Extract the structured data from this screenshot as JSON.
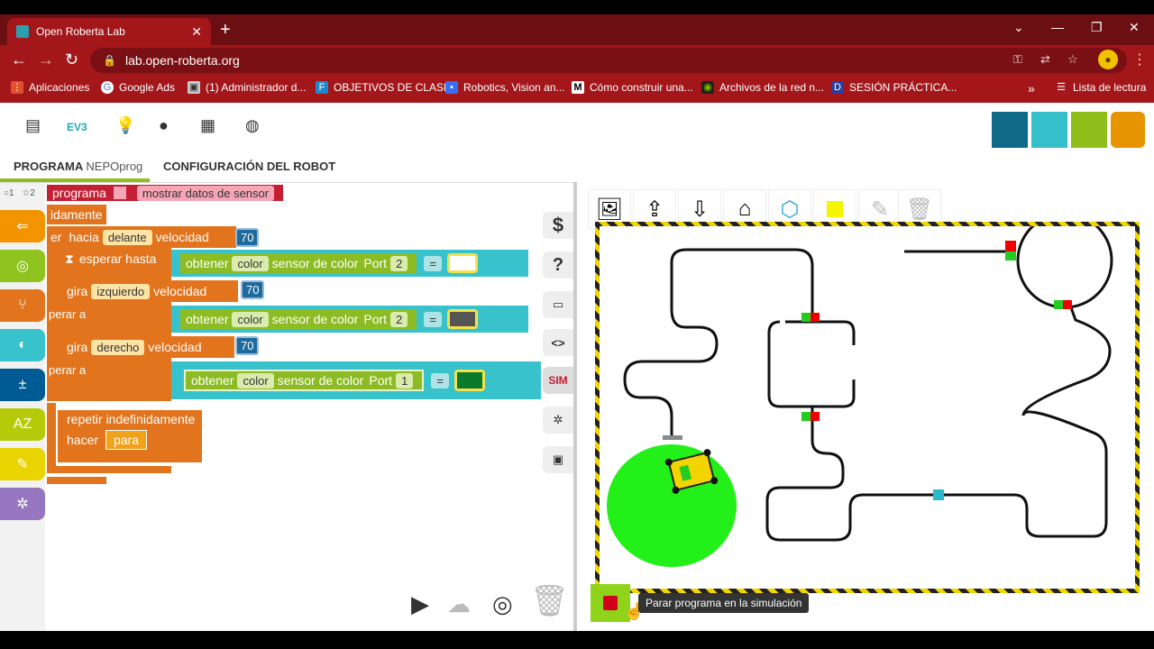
{
  "browser": {
    "tab_title": "Open Roberta Lab",
    "url": "lab.open-roberta.org",
    "bookmarks": [
      {
        "label": "Aplicaciones",
        "icon": "apps-grid-icon",
        "color": "#e0522c"
      },
      {
        "label": "Google Ads",
        "icon": "google-icon",
        "color": "#ffffff"
      },
      {
        "label": "(1) Administrador d...",
        "icon": "admin-icon",
        "color": "#cccccc"
      },
      {
        "label": "OBJETIVOS DE CLASE",
        "icon": "doc-icon",
        "color": "#1e88c9"
      },
      {
        "label": "Robotics, Vision an...",
        "icon": "robotics-icon",
        "color": "#3a6ef2"
      },
      {
        "label": "Cómo construir una...",
        "icon": "medium-icon",
        "color": "#000000"
      },
      {
        "label": "Archivos de la red n...",
        "icon": "nvidia-icon",
        "color": "#76b900"
      },
      {
        "label": "SESIÓN PRÁCTICA...",
        "icon": "d-icon",
        "color": "#2b3f9b"
      }
    ],
    "overflow": "»",
    "reading_list": "Lista de lectura"
  },
  "app": {
    "header_icons": [
      "document-icon",
      "ev3-label",
      "lightbulb-icon",
      "user-icon",
      "grid-icon",
      "globe-icon"
    ],
    "ev3_label": "EV3",
    "tabs": [
      {
        "label": "PROGRAMA",
        "sub": "NEPOprog"
      },
      {
        "label": "CONFIGURACIÓN DEL ROBOT"
      }
    ],
    "logo_colors": [
      "#0f6a87",
      "#36c0cc",
      "#8fbd19",
      "#e69500"
    ]
  },
  "workspace": {
    "corner": {
      "left": "○1",
      "right": "☆2"
    },
    "categories": [
      {
        "icon": "action-icon",
        "color": "#f29400"
      },
      {
        "icon": "sensor-icon",
        "color": "#8fc31f"
      },
      {
        "icon": "control-icon",
        "color": "#e2741d"
      },
      {
        "icon": "logic-icon",
        "color": "#38c3cc"
      },
      {
        "icon": "math-icon",
        "color": "#005a94"
      },
      {
        "icon": "text-icon",
        "color": "#b5cb09"
      },
      {
        "icon": "colour-icon",
        "color": "#ead400"
      },
      {
        "icon": "variables-icon",
        "color": "#9776c0"
      }
    ],
    "blocks": {
      "programa": "programa",
      "mostrar": "mostrar datos de sensor",
      "indefinidamente": "idamente",
      "mover": "er",
      "hacia": "hacia",
      "delante": "delante",
      "velocidad": "velocidad",
      "v1": "70",
      "esperar": "esperar hasta",
      "obtener": "obtener",
      "color": "color",
      "sensor": "sensor de color",
      "port": "Port",
      "p2": "2",
      "p1": "1",
      "eq": "=",
      "r": "r",
      "gira": "gira",
      "izquierdo": "izquierdo",
      "derecho": "derecho",
      "v2": "70",
      "v3": "70",
      "esperar_a": "perar a",
      "repetir": "repetir indefinidamente",
      "hacer": "hacer",
      "para": "para"
    },
    "side_tools": [
      {
        "label": "$",
        "icon": "variables-tool-icon"
      },
      {
        "label": "?",
        "icon": "help-icon"
      },
      {
        "label": "",
        "icon": "comment-icon"
      },
      {
        "label": "<>",
        "icon": "code-icon"
      },
      {
        "label": "SIM",
        "icon": "sim-label"
      },
      {
        "label": "",
        "icon": "debug-icon"
      },
      {
        "label": "",
        "icon": "robot-icon"
      }
    ]
  },
  "simulation": {
    "tools": [
      "image-icon",
      "upload-icon",
      "download-icon",
      "import-icon",
      "cube-icon",
      "yellow-color-icon",
      "eyedropper-icon",
      "trash-icon"
    ],
    "tooltip": "Parar programa en la simulación"
  }
}
